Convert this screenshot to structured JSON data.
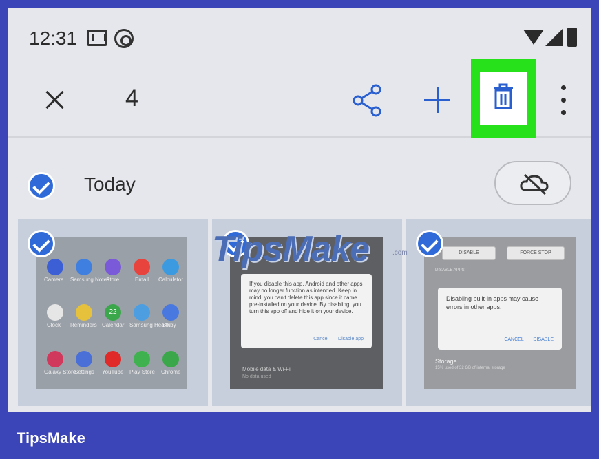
{
  "status_bar": {
    "time": "12:31",
    "icons": [
      "mail-icon",
      "at-sign-icon",
      "wifi-icon",
      "cell-signal-icon",
      "battery-icon"
    ]
  },
  "action_bar": {
    "selected_count": "4",
    "actions": [
      "close-icon",
      "share-icon",
      "add-icon",
      "trash-icon",
      "more-vert-icon"
    ],
    "highlight_color": "#27e21a",
    "accent_color": "#2a5fd0"
  },
  "section": {
    "date_label": "Today",
    "cloud_icon": "cloud-off-icon"
  },
  "thumbnails": [
    {
      "apps": [
        {
          "label": "Camera",
          "color": "#3c5fd6"
        },
        {
          "label": "Samsung Notes",
          "color": "#3f7fe0"
        },
        {
          "label": "Store",
          "color": "#7a5ad8"
        },
        {
          "label": "Email",
          "color": "#e8433c"
        },
        {
          "label": "Calculator",
          "color": "#3c9be0"
        },
        {
          "label": "Clock",
          "color": "#e6e6e6"
        },
        {
          "label": "Reminders",
          "color": "#e6c23c"
        },
        {
          "label": "Calendar",
          "color": "#3aa84a"
        },
        {
          "label": "Samsung Health",
          "color": "#4d9ee0"
        },
        {
          "label": "Bixby",
          "color": "#4878e0"
        },
        {
          "label": "Galaxy Store",
          "color": "#d0385c"
        },
        {
          "label": "Settings",
          "color": "#4a70d8"
        },
        {
          "label": "YouTube",
          "color": "#e02a2a"
        },
        {
          "label": "Play Store",
          "color": "#3fb24f"
        },
        {
          "label": "Chrome",
          "color": "#3aa84a"
        }
      ],
      "badge": "22"
    },
    {
      "dialog_text": "If you disable this app, Android and other apps may no longer function as intended. Keep in mind, you can't delete this app since it came pre-installed on your device. By disabling, you turn this app off and hide it on your device.",
      "cancel": "Cancel",
      "confirm": "Disable app",
      "bg_item_1": "Mobile data & Wi-Fi",
      "bg_item_2": "No data used"
    },
    {
      "top_left": "DISABLE",
      "top_right": "FORCE STOP",
      "section_label": "DISABLE APPS",
      "dialog_text": "Disabling built-in apps may cause errors in other apps.",
      "cancel": "CANCEL",
      "confirm": "DISABLE",
      "storage_title": "Storage",
      "storage_sub": "15% used of 32 GB of internal storage"
    }
  ],
  "watermark": {
    "text": "TipsMake",
    "suffix": ".com"
  },
  "footer": {
    "brand": "TipsMake"
  }
}
